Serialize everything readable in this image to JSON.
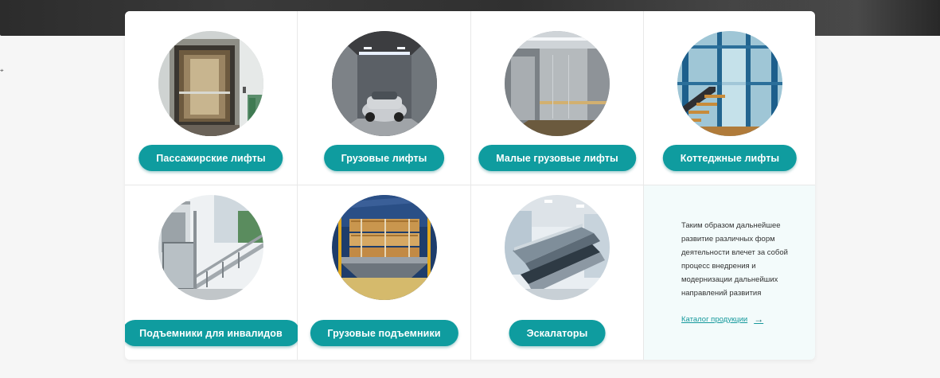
{
  "categories": [
    {
      "label": "Пассажирские лифты"
    },
    {
      "label": "Грузовые лифты"
    },
    {
      "label": "Малые грузовые лифты"
    },
    {
      "label": "Коттеджные лифты"
    },
    {
      "label": "Подъемники для инвалидов"
    },
    {
      "label": "Грузовые подъемники"
    },
    {
      "label": "Эскалаторы"
    }
  ],
  "info": {
    "text": "Таким образом дальнейшее развитие различных форм деятельности влечет за собой процесс внедрения и модернизации дальнейших направлений развития",
    "link_label": "Каталог продукции"
  },
  "icons": {
    "arrow": "arrow-right-icon"
  },
  "colors": {
    "accent": "#0f9c9f",
    "info_bg": "#f3fbfb",
    "link": "#15999c"
  }
}
